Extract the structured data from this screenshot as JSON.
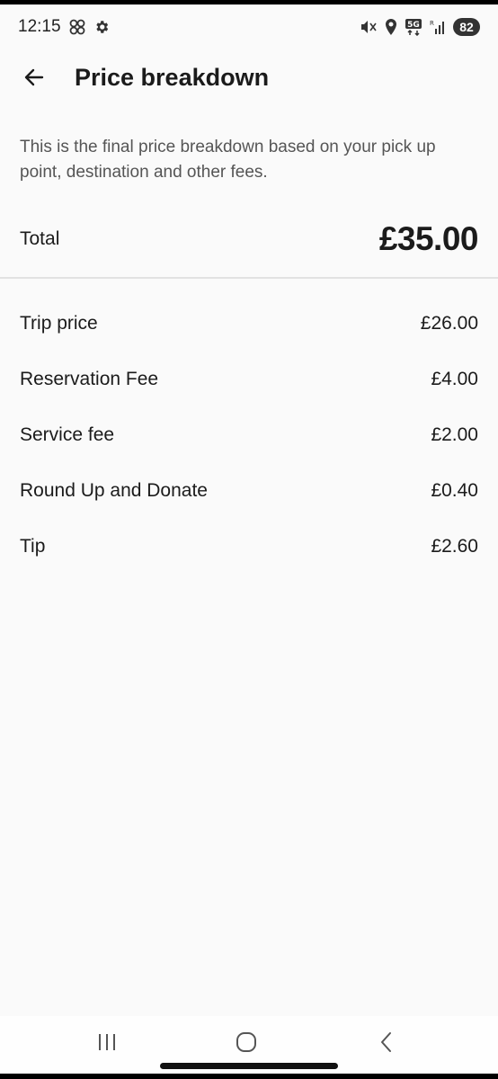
{
  "status_bar": {
    "time": "12:15",
    "battery": "82",
    "icons": [
      "pinwheel-icon",
      "settings-gear-icon",
      "mute-vibrate-icon",
      "location-icon",
      "5g-icon",
      "signal-icon"
    ]
  },
  "header": {
    "title": "Price breakdown",
    "back_icon": "back-arrow-icon"
  },
  "description": "This is the final price breakdown based on your pick up point, destination and other fees.",
  "total": {
    "label": "Total",
    "value": "£35.00"
  },
  "items": [
    {
      "label": "Trip price",
      "value": "£26.00"
    },
    {
      "label": "Reservation Fee",
      "value": "£4.00"
    },
    {
      "label": "Service fee",
      "value": "£2.00"
    },
    {
      "label": "Round Up and Donate",
      "value": "£0.40"
    },
    {
      "label": "Tip",
      "value": "£2.60"
    }
  ],
  "nav_bar": {
    "buttons": [
      "recent-apps-icon",
      "home-icon",
      "back-icon"
    ]
  },
  "colors": {
    "background": "#fafafa",
    "text_primary": "#1b1b1b",
    "text_secondary": "#555555",
    "divider": "#e2e2e2"
  }
}
